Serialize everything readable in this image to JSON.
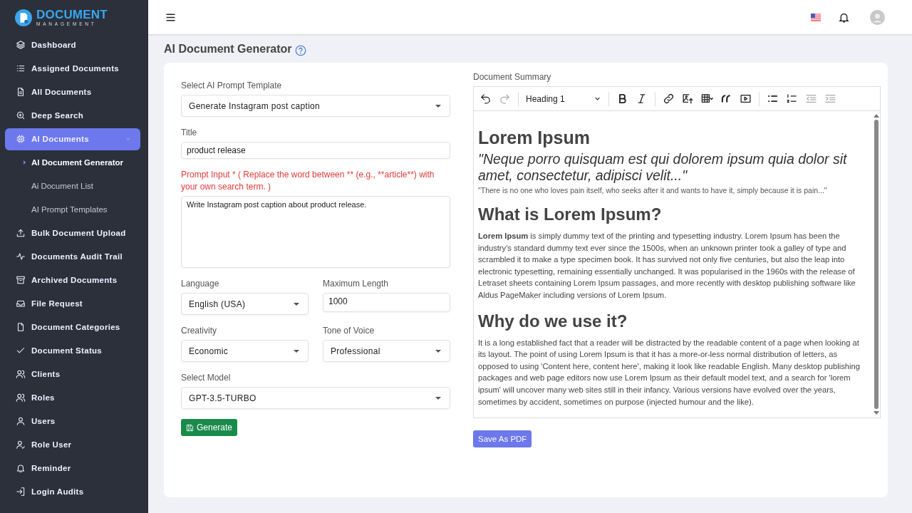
{
  "brand": {
    "name": "DOCUMENT",
    "tagline": "MANAGEMENT"
  },
  "sidebar": {
    "items": [
      {
        "label": "Dashboard",
        "selected": false
      },
      {
        "label": "Assigned Documents",
        "selected": false
      },
      {
        "label": "All Documents",
        "selected": false
      },
      {
        "label": "Deep Search",
        "selected": false
      },
      {
        "label": "AI Documents",
        "selected": true,
        "expanded": true,
        "children": [
          {
            "label": "AI Document Generator",
            "selected": true
          },
          {
            "label": "Ai Document List",
            "selected": false
          },
          {
            "label": "AI Prompt Templates",
            "selected": false
          }
        ]
      },
      {
        "label": "Bulk Document Upload",
        "selected": false
      },
      {
        "label": "Documents Audit Trail",
        "selected": false
      },
      {
        "label": "Archived Documents",
        "selected": false
      },
      {
        "label": "File Request",
        "selected": false
      },
      {
        "label": "Document Categories",
        "selected": false
      },
      {
        "label": "Document Status",
        "selected": false
      },
      {
        "label": "Clients",
        "selected": false
      },
      {
        "label": "Roles",
        "selected": false
      },
      {
        "label": "Users",
        "selected": false
      },
      {
        "label": "Role User",
        "selected": false
      },
      {
        "label": "Reminder",
        "selected": false
      },
      {
        "label": "Login Audits",
        "selected": false
      }
    ]
  },
  "page_title": "AI Document Generator",
  "form": {
    "template": {
      "label": "Select AI Prompt Template",
      "value": "Generate Instagram post caption"
    },
    "title": {
      "label": "Title",
      "value": "product release"
    },
    "prompt": {
      "label": "Prompt Input * ( Replace the word between ** (e.g., **article**) with your own search term. )",
      "value": "Write Instagram post caption about product release."
    },
    "language": {
      "label": "Language",
      "value": "English (USA)"
    },
    "max_length": {
      "label": "Maximum Length",
      "value": "1000"
    },
    "creativity": {
      "label": "Creativity",
      "value": "Economic"
    },
    "tone": {
      "label": "Tone of Voice",
      "value": "Professional"
    },
    "model": {
      "label": "Select Model",
      "value": "GPT-3.5-TURBO"
    },
    "generate_button": "Generate"
  },
  "editor": {
    "label": "Document Summary",
    "heading_style": "Heading 1",
    "toolbar": [
      {
        "kind": "undo",
        "disabled": false
      },
      {
        "kind": "redo",
        "disabled": true
      },
      {
        "kind": "sep"
      },
      {
        "kind": "heading"
      },
      {
        "kind": "sep"
      },
      {
        "kind": "bold",
        "disabled": false
      },
      {
        "kind": "italic",
        "disabled": false
      },
      {
        "kind": "sep"
      },
      {
        "kind": "link",
        "disabled": false
      },
      {
        "kind": "image",
        "disabled": false
      },
      {
        "kind": "table",
        "disabled": false
      },
      {
        "kind": "quote",
        "disabled": false
      },
      {
        "kind": "media",
        "disabled": false
      },
      {
        "kind": "sep"
      },
      {
        "kind": "bullets",
        "disabled": false
      },
      {
        "kind": "numbers",
        "disabled": false
      },
      {
        "kind": "outdent",
        "disabled": true
      },
      {
        "kind": "indent",
        "disabled": true
      }
    ],
    "content": [
      {
        "kind": "h1",
        "text": "Lorem Ipsum"
      },
      {
        "kind": "quote",
        "text": "\"Neque porro quisquam est qui dolorem ipsum quia dolor sit amet, consectetur, adipisci velit...\""
      },
      {
        "kind": "small",
        "text": "\"There is no one who loves pain itself, who seeks after it and wants to have it, simply because it is pain...\""
      },
      {
        "kind": "h2",
        "text": "What is Lorem Ipsum?"
      },
      {
        "kind": "p",
        "text": "**Lorem Ipsum** is simply dummy text of the printing and typesetting industry. Lorem Ipsum has been the industry's standard dummy text ever since the 1500s, when an unknown printer took a galley of type and scrambled it to make a type specimen book. It has survived not only five centuries, but also the leap into electronic typesetting, remaining essentially unchanged. It was popularised in the 1960s with the release of Letraset sheets containing Lorem Ipsum passages, and more recently with desktop publishing software like Aldus PageMaker including versions of Lorem Ipsum."
      },
      {
        "kind": "h2",
        "text": "Why do we use it?"
      },
      {
        "kind": "p",
        "text": "It is a long established fact that a reader will be distracted by the readable content of a page when looking at its layout. The point of using Lorem Ipsum is that it has a more-or-less normal distribution of letters, as opposed to using 'Content here, content here', making it look like readable English. Many desktop publishing packages and web page editors now use Lorem Ipsum as their default model text, and a search for 'lorem ipsum' will uncover many web sites still in their infancy. Various versions have evolved over the years, sometimes by accident, sometimes on purpose (injected humour and the like)."
      }
    ],
    "save_button": "Save As PDF"
  }
}
